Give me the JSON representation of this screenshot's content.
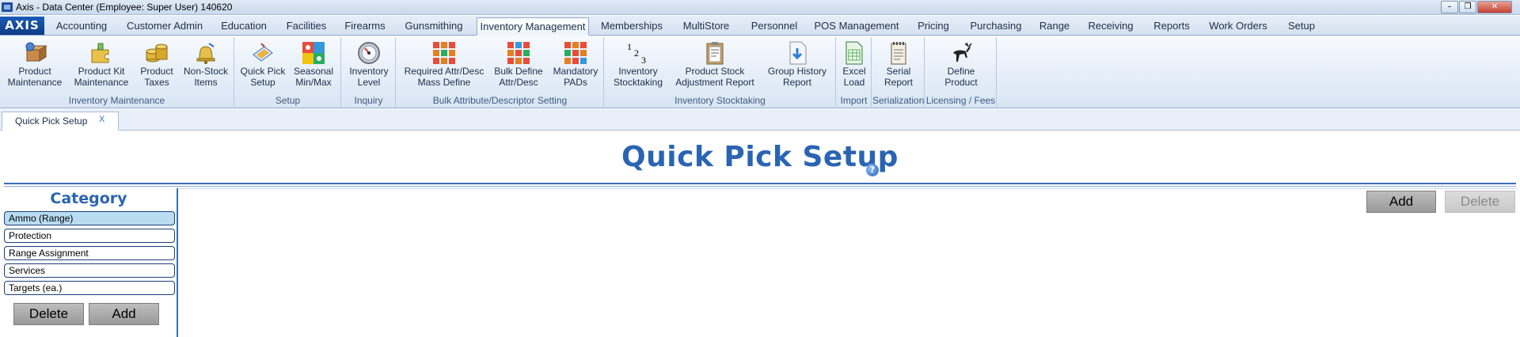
{
  "window": {
    "title": "Axis - Data Center  (Employee: Super User) 140620",
    "min_glyph": "–",
    "max_glyph": "❐",
    "close_glyph": "✕"
  },
  "ribbon": {
    "logo_text": "AXIS",
    "tabs": [
      {
        "label": "Accounting"
      },
      {
        "label": "Customer Admin"
      },
      {
        "label": "Education"
      },
      {
        "label": "Facilities"
      },
      {
        "label": "Firearms"
      },
      {
        "label": "Gunsmithing"
      },
      {
        "label": "Inventory Management"
      },
      {
        "label": "Memberships"
      },
      {
        "label": "MultiStore"
      },
      {
        "label": "Personnel"
      },
      {
        "label": "POS Management"
      },
      {
        "label": "Pricing"
      },
      {
        "label": "Purchasing"
      },
      {
        "label": "Range"
      },
      {
        "label": "Receiving"
      },
      {
        "label": "Reports"
      },
      {
        "label": "Work Orders"
      },
      {
        "label": "Setup"
      }
    ],
    "active_tab": "Inventory Management",
    "groups": [
      {
        "label": "Inventory Maintenance",
        "buttons": [
          {
            "l1": "Product",
            "l2": "Maintenance",
            "icon": "product-maintenance-icon"
          },
          {
            "l1": "Product Kit",
            "l2": "Maintenance",
            "icon": "puzzle-icon"
          },
          {
            "l1": "Product",
            "l2": "Taxes",
            "icon": "coins-icon"
          },
          {
            "l1": "Non-Stock",
            "l2": "Items",
            "icon": "bell-icon"
          }
        ]
      },
      {
        "label": "Setup",
        "buttons": [
          {
            "l1": "Quick Pick",
            "l2": "Setup",
            "icon": "quick-pick-icon"
          },
          {
            "l1": "Seasonal",
            "l2": "Min/Max",
            "icon": "seasons-icon"
          }
        ]
      },
      {
        "label": "Inquiry",
        "buttons": [
          {
            "l1": "Inventory",
            "l2": "Level",
            "icon": "gauge-icon"
          }
        ]
      },
      {
        "label": "Bulk Attribute/Descriptor Setting",
        "buttons": [
          {
            "l1": "Required Attr/Desc",
            "l2": "Mass Define",
            "icon": "grid-icon"
          },
          {
            "l1": "Bulk Define",
            "l2": "Attr/Desc",
            "icon": "grid-icon"
          },
          {
            "l1": "Mandatory",
            "l2": "PADs",
            "icon": "grid-icon"
          }
        ]
      },
      {
        "label": "Inventory Stocktaking",
        "buttons": [
          {
            "l1": "Inventory",
            "l2": "Stocktaking",
            "icon": "numbers-icon"
          },
          {
            "l1": "Product Stock",
            "l2": "Adjustment Report",
            "icon": "clipboard-icon"
          },
          {
            "l1": "Group History",
            "l2": "Report",
            "icon": "download-doc-icon"
          }
        ]
      },
      {
        "label": "Import",
        "buttons": [
          {
            "l1": "Excel",
            "l2": "Load",
            "icon": "excel-icon"
          }
        ]
      },
      {
        "label": "Serialization",
        "buttons": [
          {
            "l1": "Serial",
            "l2": "Report",
            "icon": "notepad-icon"
          }
        ]
      },
      {
        "label": "Licensing / Fees",
        "buttons": [
          {
            "l1": "Define",
            "l2": "Product",
            "icon": "deer-icon"
          }
        ]
      }
    ]
  },
  "doc_tab": {
    "label": "Quick Pick Setup",
    "close": "X"
  },
  "page": {
    "title": "Quick Pick Setup",
    "help": "?"
  },
  "category": {
    "title": "Category",
    "items": [
      {
        "label": "Ammo (Range)",
        "selected": true
      },
      {
        "label": "Protection",
        "selected": false
      },
      {
        "label": "Range Assignment",
        "selected": false
      },
      {
        "label": "Services",
        "selected": false
      },
      {
        "label": "Targets (ea.)",
        "selected": false
      }
    ],
    "delete_label": "Delete",
    "add_label": "Add"
  },
  "content": {
    "add_label": "Add",
    "delete_label": "Delete"
  }
}
